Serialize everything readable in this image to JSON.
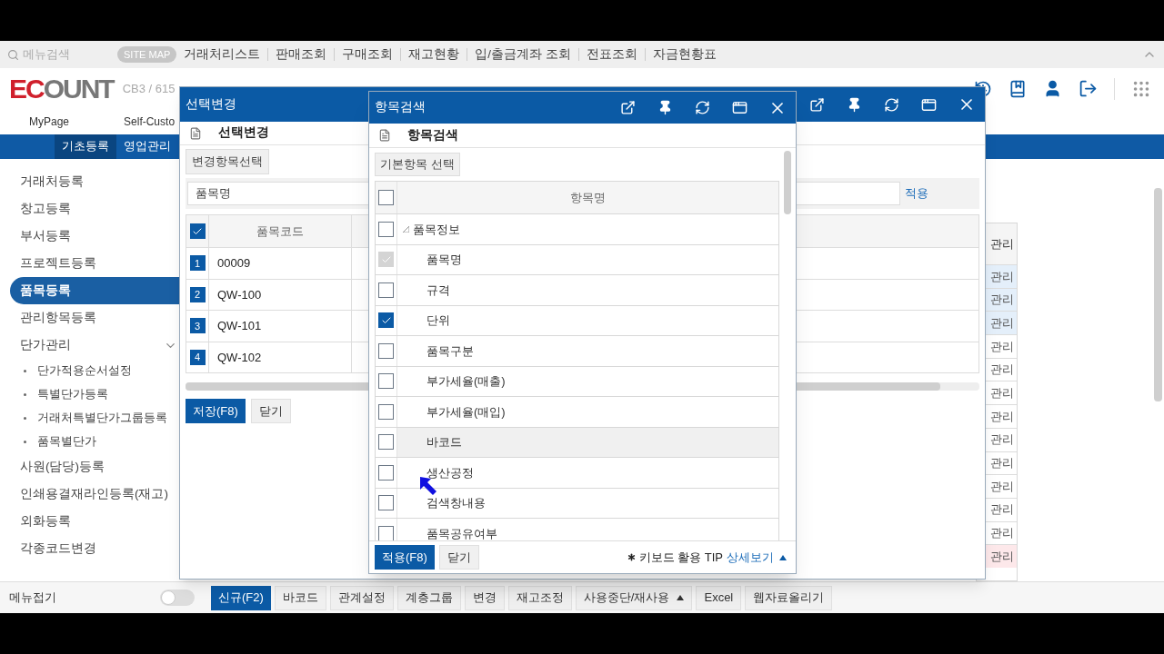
{
  "top_nav": {
    "search_placeholder": "메뉴검색",
    "site_map": "SITE MAP",
    "links": [
      "거래처리스트",
      "판매조회",
      "구매조회",
      "재고현황",
      "입/출금계좌 조회",
      "전표조회",
      "자금현황표"
    ]
  },
  "header": {
    "logo": "ECOUNT",
    "account": "CB3 / 615",
    "links": [
      "MyPage",
      "Self-Custo"
    ]
  },
  "main_tabs": [
    {
      "label": "기초등록",
      "selected": true
    },
    {
      "label": "영업관리",
      "selected": false
    }
  ],
  "sidebar": {
    "items": [
      {
        "label": "거래처등록",
        "selected": false
      },
      {
        "label": "창고등록",
        "selected": false
      },
      {
        "label": "부서등록",
        "selected": false
      },
      {
        "label": "프로젝트등록",
        "selected": false
      },
      {
        "label": "품목등록",
        "selected": true
      },
      {
        "label": "관리항목등록",
        "selected": false
      },
      {
        "label": "단가관리",
        "selected": false,
        "expanded": true,
        "children": [
          {
            "label": "단가적용순서설정",
            "selected": false
          },
          {
            "label": "특별단가등록",
            "selected": false
          },
          {
            "label": "거래처특별단가그룹등록",
            "selected": false
          },
          {
            "label": "품목별단가",
            "selected": false
          }
        ]
      },
      {
        "label": "사원(담당)등록",
        "selected": false
      },
      {
        "label": "인쇄용결재라인등록(재고)",
        "selected": false
      },
      {
        "label": "외화등록",
        "selected": false
      },
      {
        "label": "각종코드변경",
        "selected": false
      }
    ],
    "collapse": {
      "label": "메뉴접기",
      "on": false
    }
  },
  "background_table": {
    "column": "관리",
    "rows": [
      {
        "text": "관리",
        "color": "#e4effa"
      },
      {
        "text": "관리",
        "color": "#e4effa"
      },
      {
        "text": "관리",
        "color": "#e4effa"
      },
      {
        "text": "관리",
        "color": "#ffffff"
      },
      {
        "text": "관리",
        "color": "#ffffff"
      },
      {
        "text": "관리",
        "color": "#ffffff"
      },
      {
        "text": "관리",
        "color": "#ffffff"
      },
      {
        "text": "관리",
        "color": "#ffffff"
      },
      {
        "text": "관리",
        "color": "#ffffff"
      },
      {
        "text": "관리",
        "color": "#ffffff"
      },
      {
        "text": "관리",
        "color": "#ffffff"
      },
      {
        "text": "관리",
        "color": "#ffffff"
      },
      {
        "text": "관리",
        "color": "#fde8ea"
      }
    ]
  },
  "toolbar": [
    {
      "label": "신규(F2)",
      "kind": "primary"
    },
    {
      "label": "바코드",
      "kind": "default"
    },
    {
      "label": "관계설정",
      "kind": "default"
    },
    {
      "label": "계층그룹",
      "kind": "default"
    },
    {
      "label": "변경",
      "kind": "default"
    },
    {
      "label": "재고조정",
      "kind": "default"
    },
    {
      "label": "사용중단/재사용",
      "kind": "menu"
    },
    {
      "label": "Excel",
      "kind": "default"
    },
    {
      "label": "웹자료올리기",
      "kind": "default"
    }
  ],
  "dialog_change": {
    "title": "선택변경",
    "heading": "선택변경",
    "select_button": "변경항목선택",
    "field_value": "품목명",
    "apply_link": "적용",
    "all_checked": true,
    "columns": [
      "품목코드"
    ],
    "rows": [
      {
        "number": "1",
        "code": "00009"
      },
      {
        "number": "2",
        "code": "QW-100"
      },
      {
        "number": "3",
        "code": "QW-101"
      },
      {
        "number": "4",
        "code": "QW-102"
      }
    ],
    "buttons": [
      {
        "label": "저장(F8)",
        "kind": "primary"
      },
      {
        "label": "닫기",
        "kind": "default"
      }
    ]
  },
  "dialog_search": {
    "title": "항목검색",
    "heading": "항목검색",
    "preset_button": "기본항목 선택",
    "all_checked": false,
    "column": "항목명",
    "tree": [
      {
        "label": "품목정보",
        "checked": false,
        "disabled": false,
        "highlighted": false,
        "expanded": true,
        "children": [
          {
            "label": "품목명",
            "checked": true,
            "disabled": true,
            "highlighted": false
          },
          {
            "label": "규격",
            "checked": false,
            "disabled": false,
            "highlighted": false
          },
          {
            "label": "단위",
            "checked": true,
            "disabled": false,
            "highlighted": false
          },
          {
            "label": "품목구분",
            "checked": false,
            "disabled": false,
            "highlighted": false
          },
          {
            "label": "부가세율(매출)",
            "checked": false,
            "disabled": false,
            "highlighted": false
          },
          {
            "label": "부가세율(매입)",
            "checked": false,
            "disabled": false,
            "highlighted": false
          },
          {
            "label": "바코드",
            "checked": false,
            "disabled": false,
            "highlighted": true
          },
          {
            "label": "생산공정",
            "checked": false,
            "disabled": false,
            "highlighted": false
          },
          {
            "label": "검색창내용",
            "checked": false,
            "disabled": false,
            "highlighted": false
          },
          {
            "label": "품목공유여부",
            "checked": false,
            "disabled": false,
            "highlighted": false
          }
        ]
      }
    ],
    "buttons": [
      {
        "label": "적용(F8)",
        "kind": "primary"
      },
      {
        "label": "닫기",
        "kind": "default"
      }
    ],
    "tip": "키보드 활용 TIP",
    "tip_link": "상세보기"
  }
}
